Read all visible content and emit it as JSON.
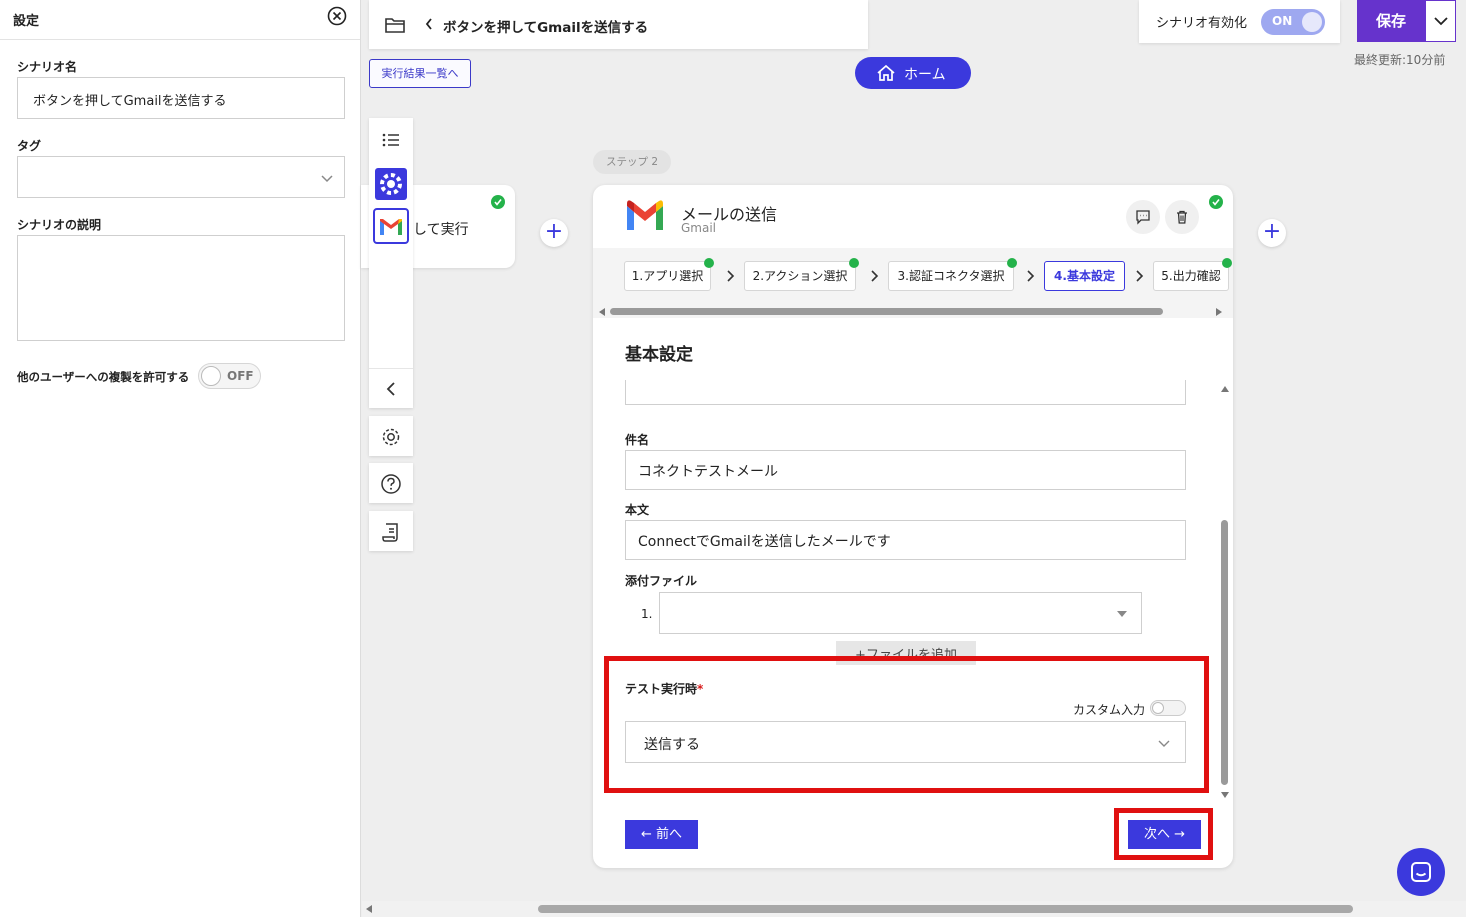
{
  "left_panel": {
    "title": "設定",
    "scenario_name_label": "シナリオ名",
    "scenario_name_value": "ボタンを押してGmailを送信する",
    "tag_label": "タグ",
    "tag_value": "",
    "description_label": "シナリオの説明",
    "description_value": "",
    "allow_copy_label": "他のユーザーへの複製を許可する",
    "allow_copy_toggle": "OFF"
  },
  "header": {
    "scenario_title": "ボタンを押してGmailを送信する",
    "results_link": "実行結果一覧へ",
    "home_button": "ホーム",
    "enable_label": "シナリオ有効化",
    "enable_toggle": "ON",
    "save_button": "保存",
    "last_updated": "最終更新:10分前"
  },
  "canvas": {
    "trigger_card_text": "して実行",
    "step_pill": "ステップ 2"
  },
  "card": {
    "title": "メールの送信",
    "app_name": "Gmail",
    "steps": [
      {
        "label": "1.アプリ選択"
      },
      {
        "label": "2.アクション選択"
      },
      {
        "label": "3.認証コネクタ選択"
      },
      {
        "label": "4.基本設定"
      },
      {
        "label": "5.出力確認"
      }
    ],
    "section_title": "基本設定",
    "subject_label": "件名",
    "subject_value": "コネクトテストメール",
    "body_label": "本文",
    "body_value": "ConnectでGmailを送信したメールです",
    "attachment_label": "添付ファイル",
    "attachment_index": "1.",
    "add_file_button": "+ファイルを追加",
    "test_label": "テスト実行時",
    "required_mark": "*",
    "custom_input_label": "カスタム入力",
    "test_value": "送信する",
    "prev_button": "← 前へ",
    "next_button": "次へ →"
  },
  "colors": {
    "accent": "#3b39dd",
    "save": "#6633cc",
    "highlight": "#e01010",
    "success": "#24b24a"
  }
}
